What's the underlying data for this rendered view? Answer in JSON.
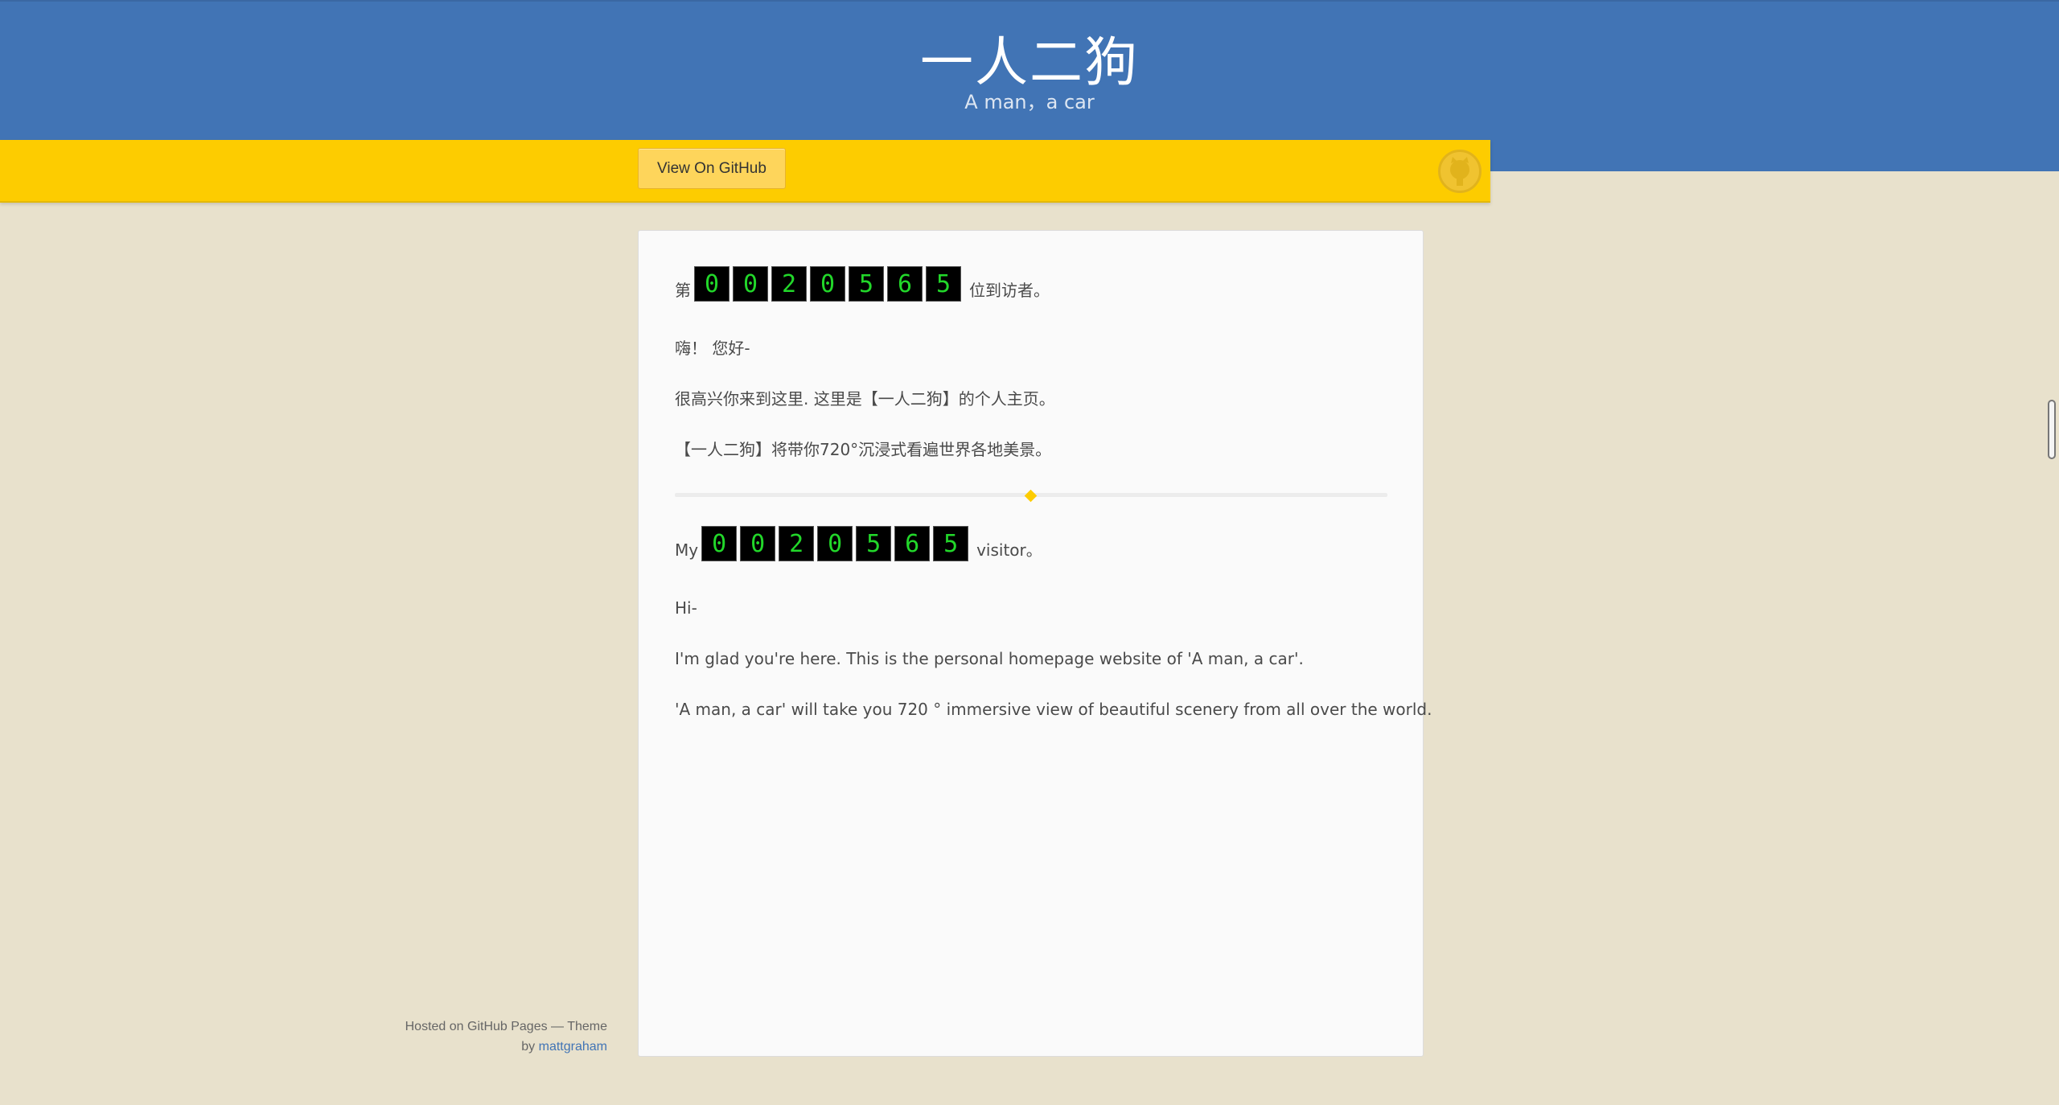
{
  "header": {
    "title": "一人二狗",
    "tagline": "A man，a car"
  },
  "ribbon": {
    "github_button": "View On GitHub",
    "octocat_icon": "github-octocat-icon"
  },
  "content": {
    "zh": {
      "counter_prefix": "第",
      "counter_suffix": "位到访者。",
      "counter_digits": [
        "0",
        "0",
        "2",
        "0",
        "5",
        "6",
        "5"
      ],
      "greeting": "嗨！ 您好-",
      "line1": "很高兴你来到这里. 这里是【一人二狗】的个人主页。",
      "line2": "【一人二狗】将带你720°沉浸式看遍世界各地美景。"
    },
    "en": {
      "counter_prefix": "My",
      "counter_suffix": "visitor。",
      "counter_digits": [
        "0",
        "0",
        "2",
        "0",
        "5",
        "6",
        "5"
      ],
      "greeting": "Hi-",
      "line1": "I'm glad you're here. This is the personal homepage website of 'A man, a car'.",
      "line2": "'A man, a car' will take you 720 ° immersive view of beautiful scenery from all over the world."
    }
  },
  "footer": {
    "hosted": "Hosted on GitHub Pages — Theme",
    "by": "by",
    "author": "mattgraham"
  },
  "colors": {
    "header_blue": "#4174b5",
    "ribbon_yellow": "#fdcc00",
    "background": "#e8e1cc",
    "digit_green": "#22d82a"
  }
}
